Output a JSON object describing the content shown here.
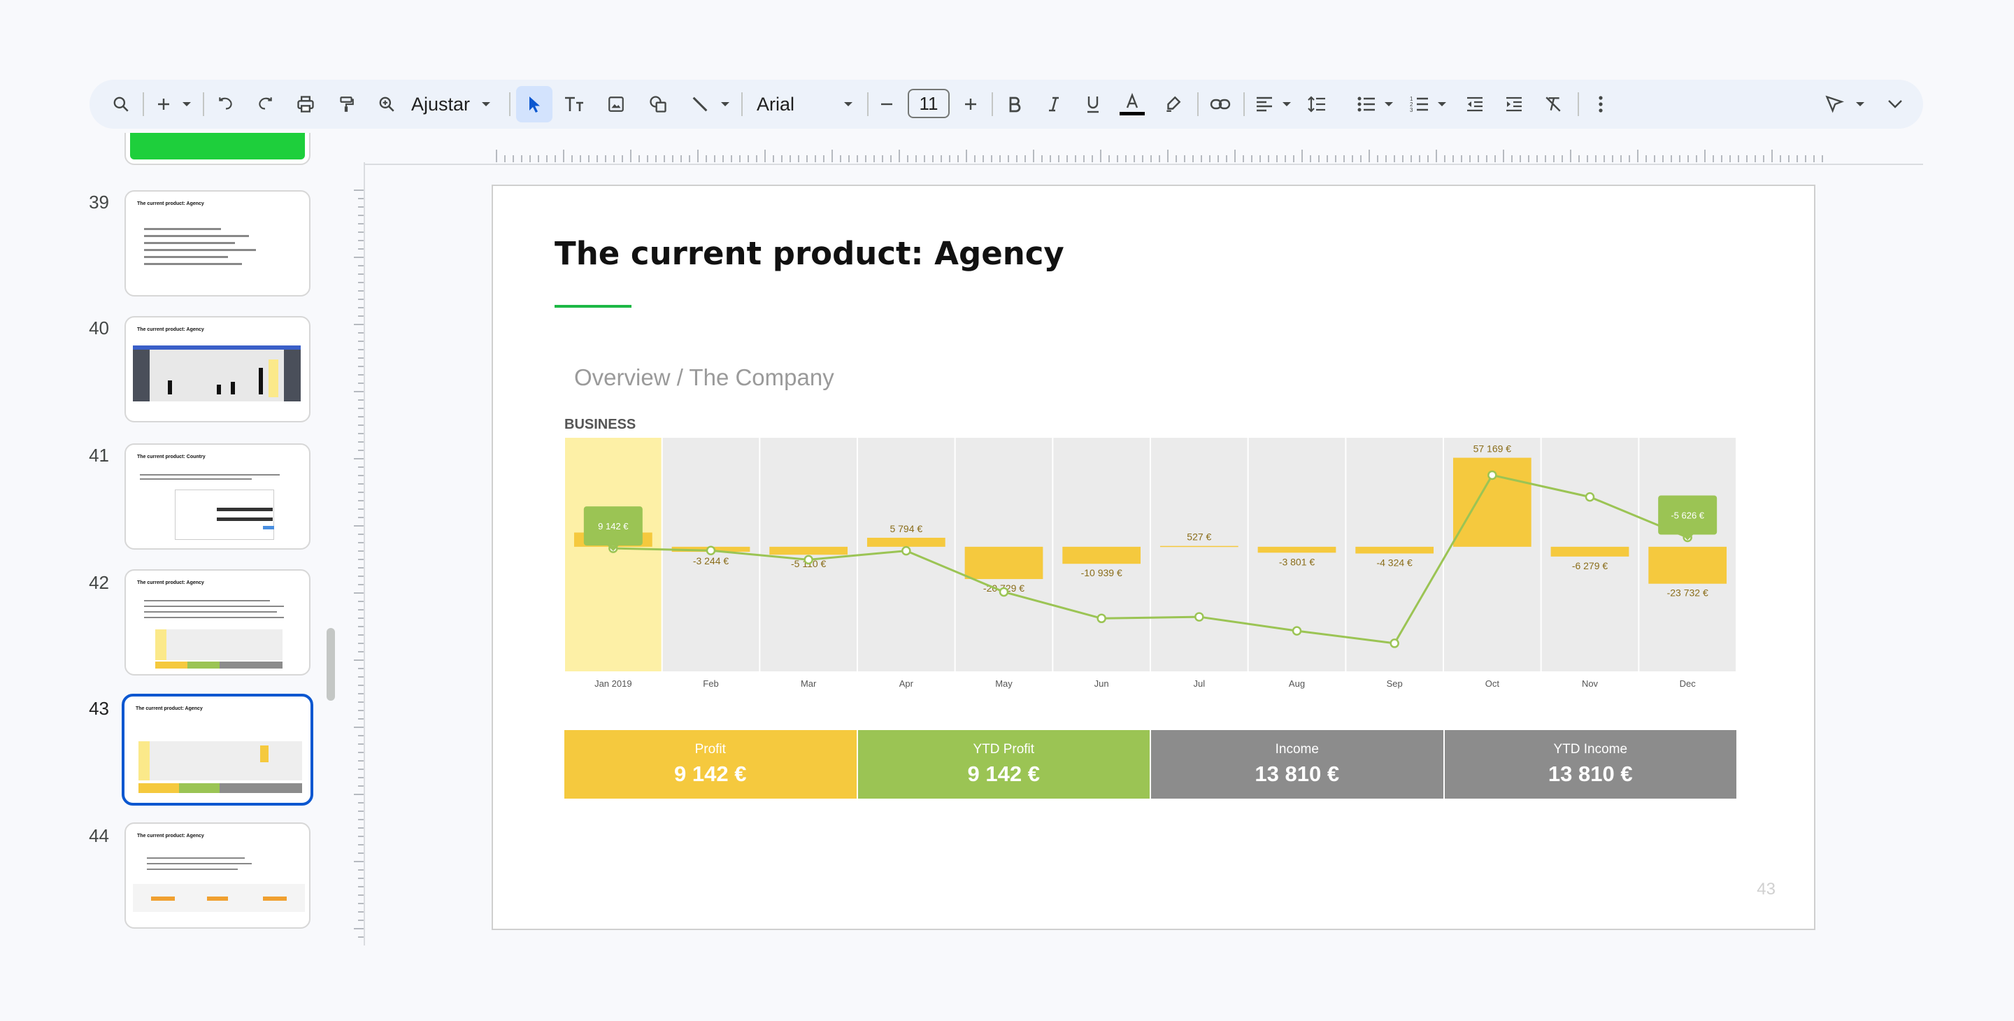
{
  "toolbar": {
    "zoom_label": "Ajustar",
    "font_name": "Arial",
    "font_size": "11",
    "icons": [
      "search-icon",
      "add-icon",
      "undo-icon",
      "redo-icon",
      "print-icon",
      "paint-format-icon",
      "zoom-icon",
      "select-icon",
      "text-box-icon",
      "image-icon",
      "shape-icon",
      "line-icon",
      "decrease-font-icon",
      "increase-font-icon",
      "bold-icon",
      "italic-icon",
      "underline-icon",
      "text-color-icon",
      "highlight-icon",
      "link-icon",
      "align-icon",
      "line-spacing-icon",
      "bullet-list-icon",
      "numbered-list-icon",
      "decrease-indent-icon",
      "increase-indent-icon",
      "clear-format-icon",
      "more-icon",
      "pen-icon",
      "collapse-icon"
    ],
    "colors": {
      "text_color_bar": "#000000",
      "active_bg": "#d3e3fd"
    }
  },
  "filmstrip": {
    "slides": [
      {
        "num": "39",
        "title": "The current product: Agency"
      },
      {
        "num": "40",
        "title": "The current product: Agency"
      },
      {
        "num": "41",
        "title": "The current product: Country"
      },
      {
        "num": "42",
        "title": "The current product: Agency"
      },
      {
        "num": "43",
        "title": "The current product: Agency"
      },
      {
        "num": "44",
        "title": "The current product: Agency"
      }
    ],
    "selected": "43"
  },
  "slide": {
    "title": "The current product: Agency",
    "subtitle": "Overview / The Company",
    "section_label": "BUSINESS",
    "page_number": "43",
    "colors": {
      "accent": "#1db845",
      "bar": "#f5c93e",
      "line": "#9bc454",
      "grey": "#8c8c8c"
    }
  },
  "chart_data": {
    "type": "bar",
    "categories": [
      "Jan 2019",
      "Feb",
      "Mar",
      "Apr",
      "May",
      "Jun",
      "Jul",
      "Aug",
      "Sep",
      "Oct",
      "Nov",
      "Dec"
    ],
    "values": [
      9142,
      -3244,
      -5110,
      5794,
      -20729,
      -10939,
      527,
      -3801,
      -4324,
      57169,
      -6279,
      -23732
    ],
    "data_labels": [
      "9 142 €",
      "-3 244 €",
      "-5 110 €",
      "5 794 €",
      "-20 729 €",
      "-10 939 €",
      "527 €",
      "-3 801 €",
      "-4 324 €",
      "57 169 €",
      "-6 279 €",
      "-23 732 €"
    ],
    "line_series": [
      -1000,
      -2400,
      -8300,
      -2600,
      -29000,
      -46000,
      -45000,
      -54000,
      -62000,
      46000,
      32000,
      6000
    ],
    "highlighted_category": "Jan 2019",
    "callouts": [
      {
        "category": "Jan 2019",
        "label": "9 142 €"
      },
      {
        "category": "Dec",
        "label": "-5 626 €"
      }
    ],
    "ylim": [
      -80000,
      70000
    ],
    "grid": false
  },
  "kpis": [
    {
      "label": "Profit",
      "value": "9 142 €",
      "color": "#f5c93e"
    },
    {
      "label": "YTD Profit",
      "value": "9 142 €",
      "color": "#9bc454"
    },
    {
      "label": "Income",
      "value": "13 810 €",
      "color": "#8c8c8c"
    },
    {
      "label": "YTD Income",
      "value": "13 810 €",
      "color": "#8c8c8c"
    }
  ]
}
